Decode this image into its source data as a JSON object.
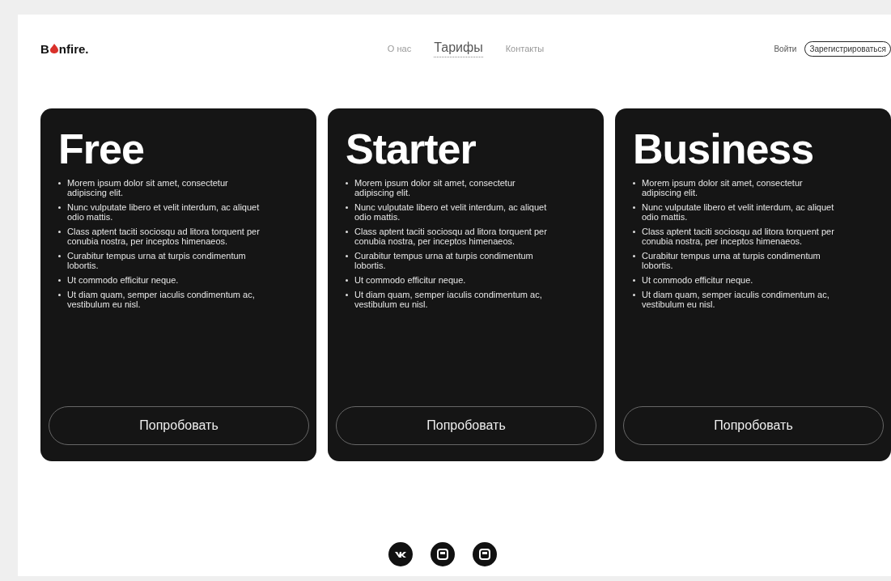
{
  "logo": {
    "before": "B",
    "after": "nfire."
  },
  "nav": [
    {
      "label": "О нас",
      "selected": false
    },
    {
      "label": "Тарифы",
      "selected": true
    },
    {
      "label": "Контакты",
      "selected": false
    }
  ],
  "auth": {
    "login": "Войти",
    "register": "Зарегистрироваться"
  },
  "plans": [
    {
      "title": "Free",
      "features": [
        "Morem ipsum dolor sit amet, consectetur adipiscing elit.",
        "Nunc vulputate libero et velit interdum, ac aliquet odio mattis.",
        "Class aptent taciti sociosqu ad litora torquent per conubia nostra, per inceptos himenaeos.",
        "Curabitur tempus urna at turpis condimentum lobortis.",
        "Ut commodo efficitur neque.",
        "Ut diam quam, semper iaculis condimentum ac, vestibulum eu nisl."
      ],
      "button": "Попробовать"
    },
    {
      "title": "Starter",
      "features": [
        "Morem ipsum dolor sit amet, consectetur adipiscing elit.",
        "Nunc vulputate libero et velit interdum, ac aliquet odio mattis.",
        "Class aptent taciti sociosqu ad litora torquent per conubia nostra, per inceptos himenaeos.",
        "Curabitur tempus urna at turpis condimentum lobortis.",
        "Ut commodo efficitur neque.",
        "Ut diam quam, semper iaculis condimentum ac, vestibulum eu nisl."
      ],
      "button": "Попробовать"
    },
    {
      "title": "Business",
      "features": [
        "Morem ipsum dolor sit amet, consectetur adipiscing elit.",
        "Nunc vulputate libero et velit interdum, ac aliquet odio mattis.",
        "Class aptent taciti sociosqu ad litora torquent per conubia nostra, per inceptos himenaeos.",
        "Curabitur tempus urna at turpis condimentum lobortis.",
        "Ut commodo efficitur neque.",
        "Ut diam quam, semper iaculis condimentum ac, vestibulum eu nisl."
      ],
      "button": "Попробовать"
    }
  ],
  "social": [
    {
      "kind": "vk"
    },
    {
      "kind": "square"
    },
    {
      "kind": "square"
    }
  ]
}
